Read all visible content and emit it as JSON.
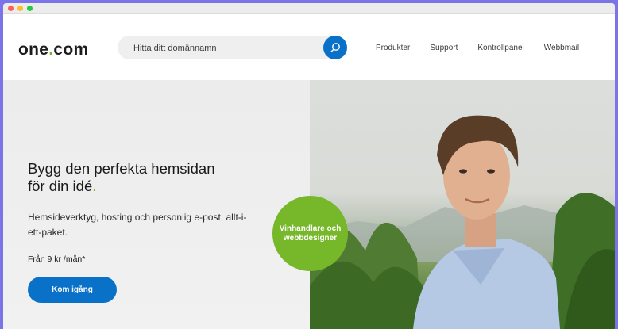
{
  "browser": {
    "dots": [
      "close",
      "minimize",
      "maximize"
    ]
  },
  "header": {
    "logo_text_prefix": "one",
    "logo_dot": ".",
    "logo_text_suffix": "com",
    "search_placeholder": "Hitta ditt domännamn",
    "nav": [
      "Produkter",
      "Support",
      "Kontrollpanel",
      "Webbmail"
    ]
  },
  "hero": {
    "headline_line1": "Bygg den perfekta hemsidan",
    "headline_line2": "för din idé",
    "headline_dot": ".",
    "subline": "Hemsideverktyg, hosting och personlig e-post, allt-i-ett-paket.",
    "price": "Från 9 kr /mån*",
    "cta_label": "Kom igång",
    "badge_text": "Vinhandlare och webbdesigner"
  },
  "colors": {
    "brand_blue": "#0a71c9",
    "brand_green": "#76b82a",
    "frame": "#7b74e8"
  },
  "icons": {
    "search": "search-icon"
  }
}
